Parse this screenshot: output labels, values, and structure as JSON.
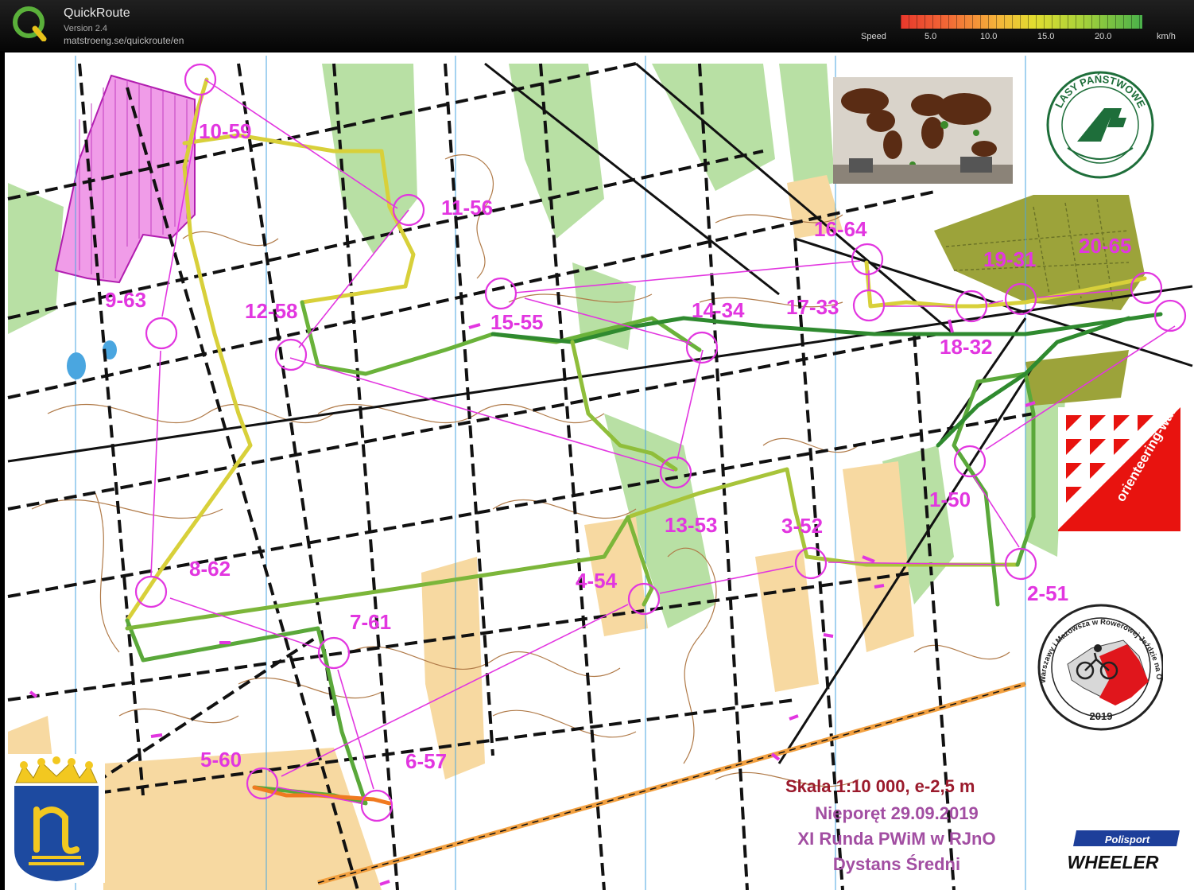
{
  "app": {
    "title": "QuickRoute",
    "version": "Version 2.4",
    "url": "matstroeng.se/quickroute/en"
  },
  "speed_legend": {
    "label": "Speed",
    "ticks": [
      "5.0",
      "10.0",
      "15.0",
      "20.0"
    ],
    "unit": "km/h",
    "colors": [
      "#e8382c",
      "#f5b43a",
      "#e2dc30",
      "#49b04a"
    ]
  },
  "map": {
    "colors": {
      "course": "#e236e0",
      "route_fast": "#2f8a2f",
      "route_medium": "#d8d03a",
      "route_slow": "#f07a20",
      "vegetation": "#b8e0a4",
      "open_land": "#f7d9a1",
      "contour": "#b07a48"
    },
    "controls": [
      {
        "label": "10-59"
      },
      {
        "label": "11-56"
      },
      {
        "label": "9-63"
      },
      {
        "label": "12-58"
      },
      {
        "label": "15-55"
      },
      {
        "label": "14-34"
      },
      {
        "label": "16-64"
      },
      {
        "label": "17-33"
      },
      {
        "label": "19-31"
      },
      {
        "label": "20-65"
      },
      {
        "label": "18-32"
      },
      {
        "label": "13-53"
      },
      {
        "label": "1-50"
      },
      {
        "label": "3-52"
      },
      {
        "label": "4-54"
      },
      {
        "label": "2-51"
      },
      {
        "label": "8-62"
      },
      {
        "label": "7-61"
      },
      {
        "label": "5-60"
      },
      {
        "label": "6-57"
      }
    ],
    "scale_text": "Skala 1:10 000, e-2,5 m",
    "event_date": "Nieporęt 29.09.2019",
    "event_round": "XI Runda PWiM w RJnO",
    "event_course": "Dystans Średni",
    "sponsor_lp": "LASY PAŃSTWOWE",
    "sponsor_orienteering": "orienteering-waw.pl",
    "sponsor_puchar": "Puchar Warszawy i Mazowsza w Rowerowej Jeździe na Orientację",
    "sponsor_puchar_year": "2019",
    "sponsor_polisport": "Polisport",
    "sponsor_wheeler": "WHEELER"
  }
}
